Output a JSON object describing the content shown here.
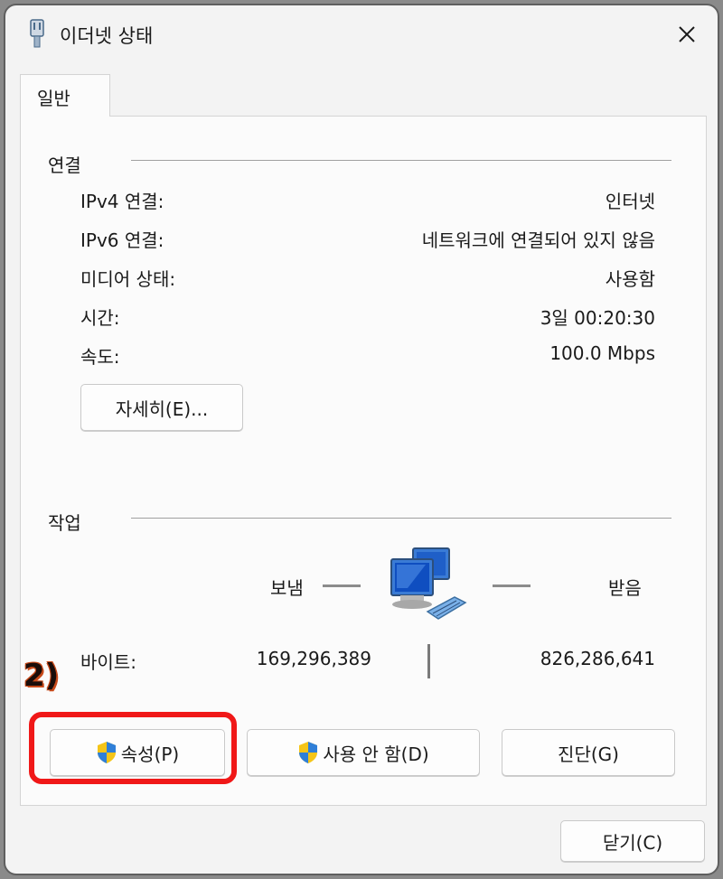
{
  "window": {
    "title": "이더넷 상태"
  },
  "tabs": [
    {
      "label": "일반"
    }
  ],
  "connection": {
    "section_title": "연결",
    "rows": [
      {
        "label": "IPv4 연결:",
        "value": "인터넷"
      },
      {
        "label": "IPv6 연결:",
        "value": "네트워크에 연결되어 있지 않음"
      },
      {
        "label": "미디어 상태:",
        "value": "사용함"
      },
      {
        "label": "시간:",
        "value": "3일 00:20:30"
      },
      {
        "label": "속도:",
        "value": "100.0 Mbps"
      }
    ],
    "details_button": "자세히(E)..."
  },
  "activity": {
    "section_title": "작업",
    "sent_label": "보냄",
    "received_label": "받음",
    "bytes_label": "바이트:",
    "bytes_sent": "169,296,389",
    "bytes_received": "826,286,641"
  },
  "buttons": {
    "properties": "속성(P)",
    "disable": "사용 안 함(D)",
    "diagnose": "진단(G)",
    "close": "닫기(C)"
  },
  "annotation": {
    "label": "2)",
    "color": "#f01818"
  },
  "icons": {
    "title_icon": "ethernet-plug-icon",
    "close_icon": "close-icon",
    "network_icon": "network-computers-icon",
    "shield_icon": "uac-shield-icon"
  }
}
